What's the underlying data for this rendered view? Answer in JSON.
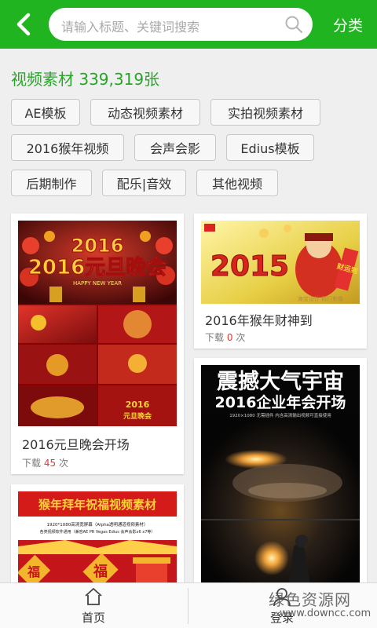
{
  "header": {
    "search_placeholder": "请输入标题、关键词搜索",
    "category_label": "分类",
    "accent": "#21b421"
  },
  "section": {
    "title": "视频素材 339,319张"
  },
  "tags": [
    "AE模板",
    "动态视频素材",
    "实拍视频素材",
    "2016猴年视频",
    "会声会影",
    "Edius模板",
    "后期制作",
    "配乐|音效",
    "其他视频"
  ],
  "cards": [
    {
      "title": "2016元旦晚会开场",
      "download_label": "下载",
      "count": "45",
      "unit": "次",
      "thumb_text": "2016元旦晚会",
      "thumb_sub": "HAPPY NEW YEAR"
    },
    {
      "title": "2016年猴年财神到",
      "download_label": "下载",
      "count": "0",
      "unit": "次",
      "thumb_text": "2015",
      "thumb_sub": "财运到",
      "thumb_caption": "海宝设计  精打影像"
    },
    {
      "thumb_line1": "震撼大气宇宙",
      "thumb_line2": "2016企业年会开场",
      "thumb_small": "1920×1080  无需插件  内含高清输出视频可直接使用"
    },
    {
      "thumb_line1": "猴年拜年祝福视频素材",
      "thumb_small1": "1920*1080高清宽屏幕（Alpha透明通道视频素材）",
      "thumb_small2": "各类视频软件通用（兼容AE PR Vegas Edius 会声会影x6 x7等）",
      "thumb_fu": "福"
    }
  ],
  "bottom_nav": {
    "home_label": "首页",
    "login_label": "登录"
  },
  "watermark": {
    "line1": "绿色资源网",
    "line2": "www.downcc.com"
  }
}
